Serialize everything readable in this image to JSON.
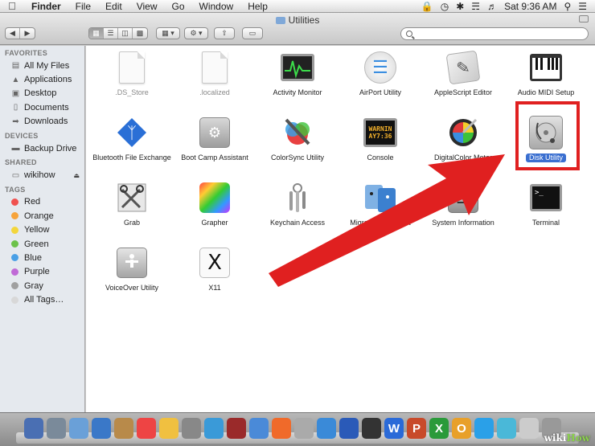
{
  "menubar": {
    "app_name": "Finder",
    "items": [
      "File",
      "Edit",
      "View",
      "Go",
      "Window",
      "Help"
    ],
    "clock": "Sat 9:36 AM"
  },
  "window": {
    "title": "Utilities"
  },
  "search": {
    "placeholder": ""
  },
  "sidebar": {
    "favorites_header": "FAVORITES",
    "favorites": [
      {
        "label": "All My Files",
        "icon": "all-files-icon"
      },
      {
        "label": "Applications",
        "icon": "applications-icon"
      },
      {
        "label": "Desktop",
        "icon": "desktop-icon"
      },
      {
        "label": "Documents",
        "icon": "documents-icon"
      },
      {
        "label": "Downloads",
        "icon": "downloads-icon"
      }
    ],
    "devices_header": "DEVICES",
    "devices": [
      {
        "label": "Backup Drive",
        "icon": "drive-icon"
      }
    ],
    "shared_header": "SHARED",
    "shared": [
      {
        "label": "wikihow",
        "icon": "computer-icon"
      }
    ],
    "tags_header": "TAGS",
    "tags": [
      {
        "label": "Red",
        "color": "#f0514f"
      },
      {
        "label": "Orange",
        "color": "#f6a33b"
      },
      {
        "label": "Yellow",
        "color": "#f3d63c"
      },
      {
        "label": "Green",
        "color": "#6cc24a"
      },
      {
        "label": "Blue",
        "color": "#4aa0e6"
      },
      {
        "label": "Purple",
        "color": "#c06ad6"
      },
      {
        "label": "Gray",
        "color": "#a0a0a0"
      },
      {
        "label": "All Tags…",
        "color": "#d8d8d8"
      }
    ]
  },
  "files": [
    {
      "label": ".DS_Store",
      "icon": "document-icon",
      "dim": true
    },
    {
      "label": ".localized",
      "icon": "document-icon",
      "dim": true
    },
    {
      "label": "Activity Monitor",
      "icon": "activity-monitor-icon"
    },
    {
      "label": "AirPort Utility",
      "icon": "airport-icon"
    },
    {
      "label": "AppleScript Editor",
      "icon": "applescript-icon"
    },
    {
      "label": "Audio MIDI Setup",
      "icon": "piano-icon"
    },
    {
      "label": "Bluetooth File Exchange",
      "icon": "bluetooth-icon"
    },
    {
      "label": "Boot Camp Assistant",
      "icon": "bootcamp-icon"
    },
    {
      "label": "ColorSync Utility",
      "icon": "colorsync-icon"
    },
    {
      "label": "Console",
      "icon": "console-icon",
      "screen_text": "WARNIN\nAY7:36"
    },
    {
      "label": "DigitalColor Meter",
      "icon": "colormeter-icon"
    },
    {
      "label": "Disk Utility",
      "icon": "disk-utility-icon",
      "selected": true
    },
    {
      "label": "Grab",
      "icon": "grab-icon"
    },
    {
      "label": "Grapher",
      "icon": "grapher-icon"
    },
    {
      "label": "Keychain Access",
      "icon": "keychain-icon"
    },
    {
      "label": "Migration Assistant",
      "icon": "migration-icon"
    },
    {
      "label": "System Information",
      "icon": "system-info-icon"
    },
    {
      "label": "Terminal",
      "icon": "terminal-icon"
    },
    {
      "label": "VoiceOver Utility",
      "icon": "voiceover-icon"
    },
    {
      "label": "X11",
      "icon": "x11-icon"
    }
  ],
  "dock": {
    "watermark_prefix": "wiki",
    "watermark_suffix": "How"
  },
  "colors": {
    "selection": "#3a6fd0",
    "annotation": "#e02020"
  }
}
